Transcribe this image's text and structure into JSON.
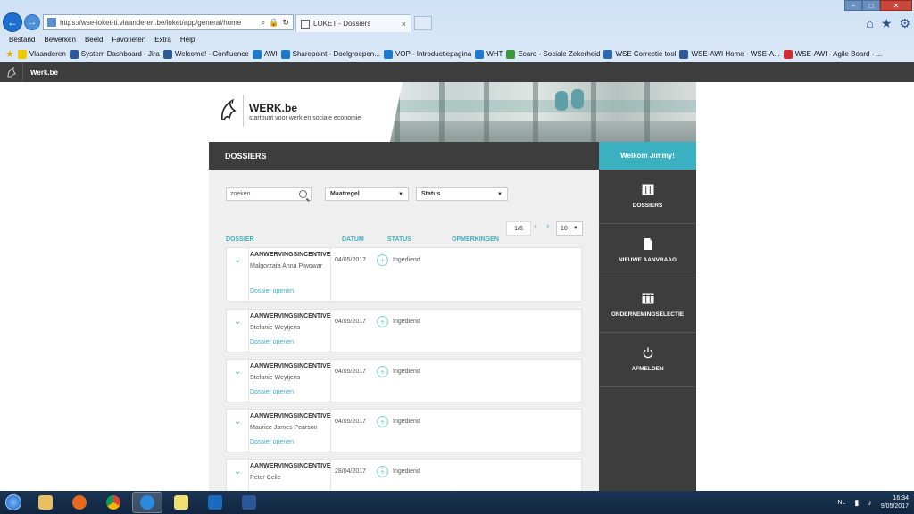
{
  "browser": {
    "url": "https://wse-loket-ti.vlaanderen.be/loket/app/general/home",
    "tab_title": "LOKET - Dossiers",
    "tab_close": "×",
    "controls": {
      "minimize": "–",
      "maximize": "□",
      "close": "✕"
    },
    "right_icons": {
      "home": "⌂",
      "favorites": "★",
      "settings": "⚙"
    },
    "menu": [
      "Bestand",
      "Bewerken",
      "Beeld",
      "Favorieten",
      "Extra",
      "Help"
    ],
    "favorites": [
      {
        "label": "Vlaanderen",
        "color": "#f0c800"
      },
      {
        "label": "System Dashboard - Jira",
        "color": "#2a5a9a"
      },
      {
        "label": "Welcome! - Confluence",
        "color": "#2a5a9a"
      },
      {
        "label": "AWI",
        "color": "#1a7ad0"
      },
      {
        "label": "Sharepoint - Doelgroepen...",
        "color": "#1a7ad0"
      },
      {
        "label": "VOP - Introductiepagina",
        "color": "#1a7ad0"
      },
      {
        "label": "WHT",
        "color": "#1a7ad0"
      },
      {
        "label": "Ecaro - Sociale Zekerheid",
        "color": "#3a9a3a"
      },
      {
        "label": "WSE Correctie tool",
        "color": "#2a6ab0"
      },
      {
        "label": "WSE-AWI Home - WSE-A...",
        "color": "#2a5a9a"
      },
      {
        "label": "WSE-AWI - Agile Board - ...",
        "color": "#d03030"
      }
    ]
  },
  "site": {
    "name": "Werk.be"
  },
  "banner": {
    "title": "WERK.be",
    "subtitle": "startpunt voor werk en sociale economie"
  },
  "dossiers": {
    "heading": "DOSSIERS",
    "search_placeholder": "zoeken",
    "filter_maatregel": "Maatregel",
    "filter_status": "Status",
    "caret": "▼",
    "pager": "1/6",
    "pager_prev": "‹",
    "pager_next": "›",
    "per_page": "10",
    "columns": {
      "dossier": "DOSSIER",
      "datum": "DATUM",
      "status": "STATUS",
      "opmerkingen": "OPMERKINGEN"
    },
    "open_label": "Dossier openen",
    "rows": [
      {
        "type": "AANWERVINGSINCENTIVE",
        "name": "Malgorzata Anna Piwowar",
        "date": "04/05/2017",
        "status": "Ingediend"
      },
      {
        "type": "AANWERVINGSINCENTIVE",
        "name": "Stefanie Weytjens",
        "date": "04/05/2017",
        "status": "Ingediend"
      },
      {
        "type": "AANWERVINGSINCENTIVE",
        "name": "Stefanie Weytjens",
        "date": "04/05/2017",
        "status": "Ingediend"
      },
      {
        "type": "AANWERVINGSINCENTIVE",
        "name": "Maurice James Pearson",
        "date": "04/05/2017",
        "status": "Ingediend"
      },
      {
        "type": "AANWERVINGSINCENTIVE",
        "name": "Peter Celie",
        "date": "28/04/2017",
        "status": "Ingediend"
      }
    ]
  },
  "sidebar": {
    "welcome": "Welkom Jimmy!",
    "items": [
      {
        "label": "DOSSIERS",
        "icon": "dossiers-icon"
      },
      {
        "label": "NIEUWE AANVRAAG",
        "icon": "document-icon"
      },
      {
        "label": "ONDERNEMINGSELECTIE",
        "icon": "building-icon"
      },
      {
        "label": "AFMELDEN",
        "icon": "power-icon"
      }
    ]
  },
  "taskbar": {
    "lang": "NL",
    "time": "16:34",
    "date": "9/05/2017"
  }
}
